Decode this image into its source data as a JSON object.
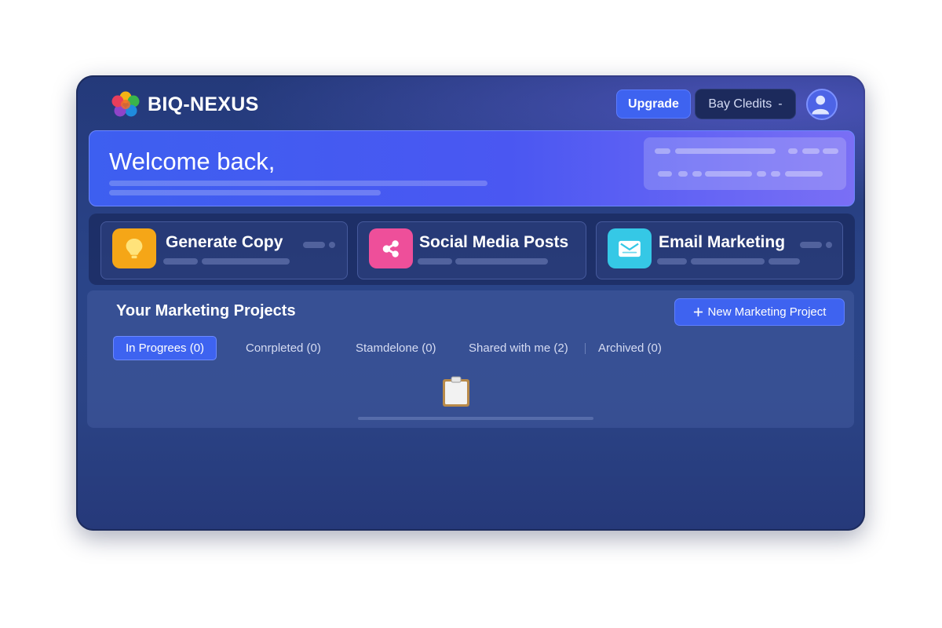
{
  "app": {
    "brand_name": "BIQ-NEXUS",
    "logo_icon": "flower-logo-icon"
  },
  "header": {
    "upgrade_label": "Upgrade",
    "credits_label": "Bay Cledits",
    "credits_value": "-",
    "avatar_icon": "user-avatar-icon"
  },
  "welcome": {
    "title": "Welcome back,"
  },
  "features": [
    {
      "title": "Generate Copy",
      "icon": "lightbulb-icon",
      "color": "#f5a617"
    },
    {
      "title": "Social Media Posts",
      "icon": "share-icon",
      "color": "#ee4f9a"
    },
    {
      "title": "Email Marketing",
      "icon": "envelope-icon",
      "color": "#35c8e6"
    }
  ],
  "projects": {
    "title": "Your Marketing Projects",
    "new_button_label": "New Marketing Project",
    "tabs": [
      {
        "label": "In Progrees (0)",
        "active": true
      },
      {
        "label": "Conrpleted (0)",
        "active": false
      },
      {
        "label": "Stamdelone (0)",
        "active": false
      },
      {
        "label": "Shared with me (2)",
        "active": false
      },
      {
        "label": "Archived (0)",
        "active": false
      }
    ],
    "empty_state_icon": "clipboard-icon"
  },
  "colors": {
    "accent": "#3e63f0",
    "window_bg": "#2a4488"
  }
}
